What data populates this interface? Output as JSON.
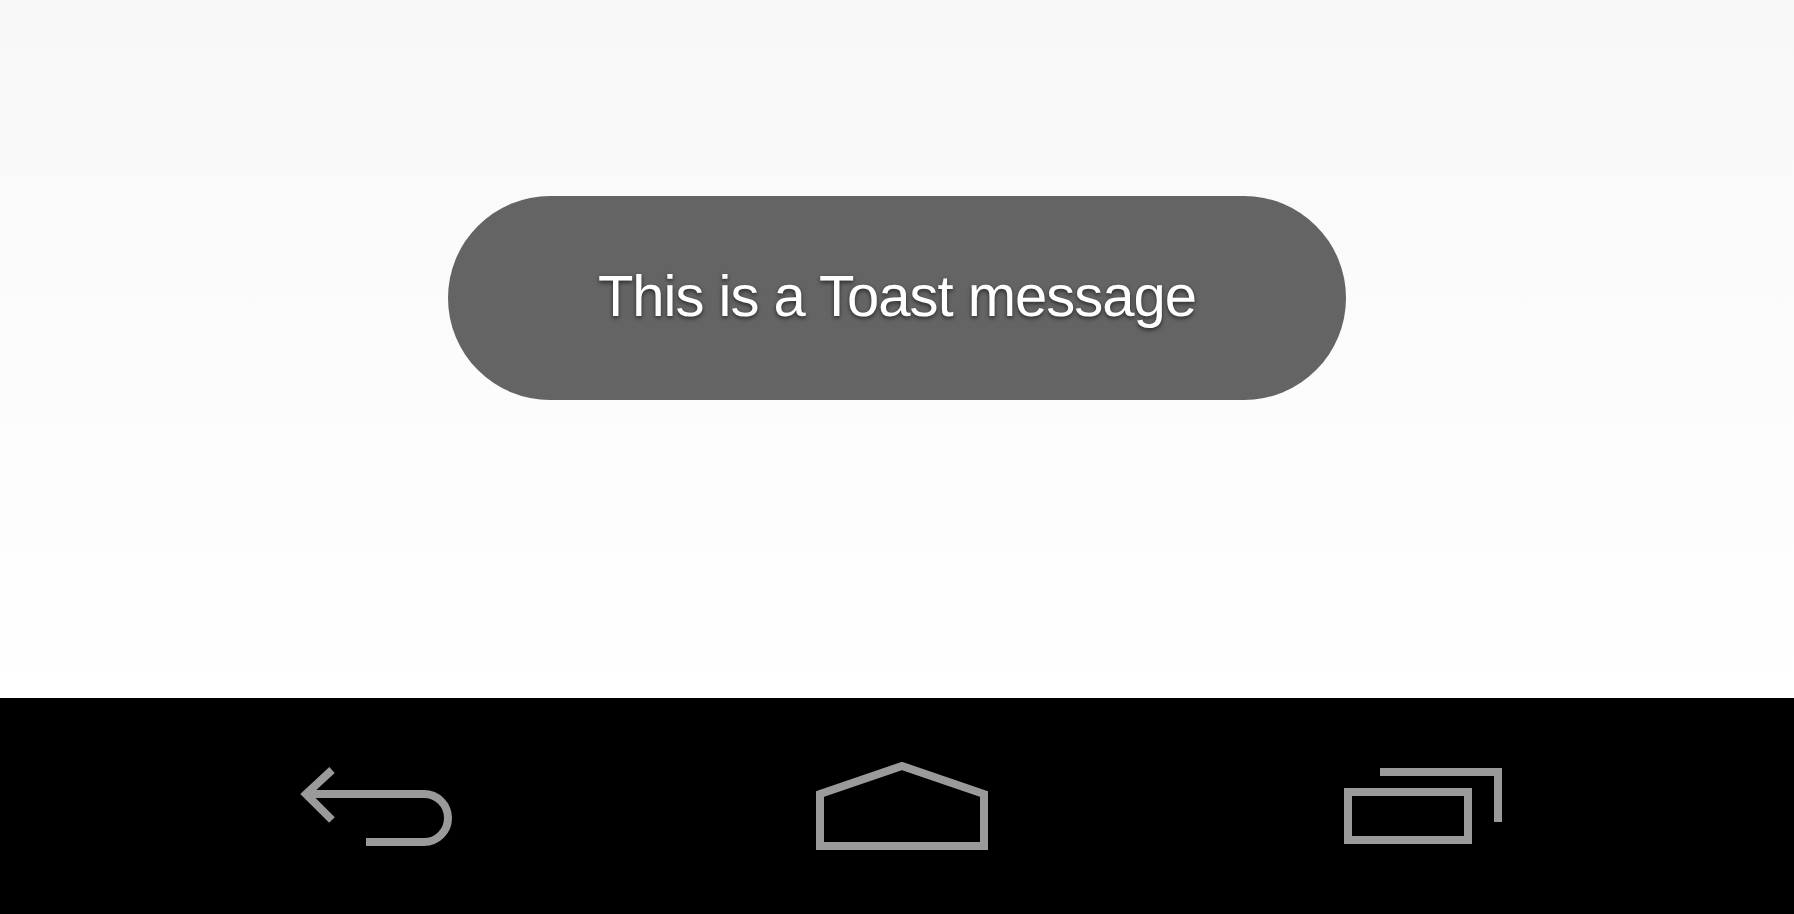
{
  "toast": {
    "message": "This is a Toast message"
  }
}
